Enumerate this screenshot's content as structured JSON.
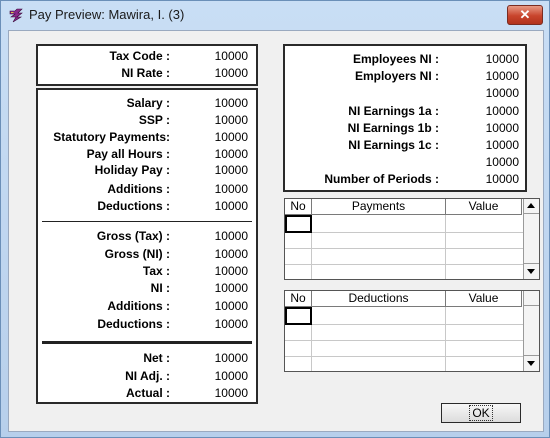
{
  "window": {
    "title": "Pay Preview: Mawira, I.  (3)",
    "close_label": "✕"
  },
  "tax_panel": {
    "rows": [
      {
        "label": "Tax Code :",
        "value": "10000"
      },
      {
        "label": "NI Rate :",
        "value": "10000"
      }
    ]
  },
  "pay_panel": {
    "section1": [
      {
        "label": "Salary :",
        "value": "10000"
      },
      {
        "label": "SSP :",
        "value": "10000"
      },
      {
        "label": "Statutory Payments:",
        "value": "10000"
      },
      {
        "label": "Pay all Hours :",
        "value": "10000"
      },
      {
        "label": "Holiday Pay :",
        "value": "10000"
      },
      {
        "label": "Additions :",
        "value": "10000"
      },
      {
        "label": "Deductions :",
        "value": "10000"
      }
    ],
    "section2": [
      {
        "label": "Gross (Tax) :",
        "value": "10000"
      },
      {
        "label": "Gross (NI) :",
        "value": "10000"
      },
      {
        "label": "Tax :",
        "value": "10000"
      },
      {
        "label": "NI :",
        "value": "10000"
      },
      {
        "label": "Additions :",
        "value": "10000"
      },
      {
        "label": "Deductions :",
        "value": "10000"
      }
    ],
    "section3": [
      {
        "label": "Net :",
        "value": "10000"
      },
      {
        "label": "NI Adj. :",
        "value": "10000"
      },
      {
        "label": "Actual :",
        "value": "10000"
      }
    ]
  },
  "ni_panel": {
    "rows": [
      {
        "label": "Employees NI :",
        "value": "10000"
      },
      {
        "label": "Employers NI :",
        "value": "10000"
      },
      {
        "label": "",
        "value": "10000"
      },
      {
        "label": "NI Earnings 1a :",
        "value": "10000"
      },
      {
        "label": "NI Earnings 1b :",
        "value": "10000"
      },
      {
        "label": "NI Earnings 1c :",
        "value": "10000"
      },
      {
        "label": "",
        "value": "10000"
      },
      {
        "label": "Number of Periods :",
        "value": "10000"
      }
    ]
  },
  "payments_grid": {
    "columns": [
      "No",
      "Payments",
      "Value"
    ]
  },
  "deductions_grid": {
    "columns": [
      "No",
      "Deductions",
      "Value"
    ]
  },
  "ok_button": {
    "label": "OK"
  }
}
